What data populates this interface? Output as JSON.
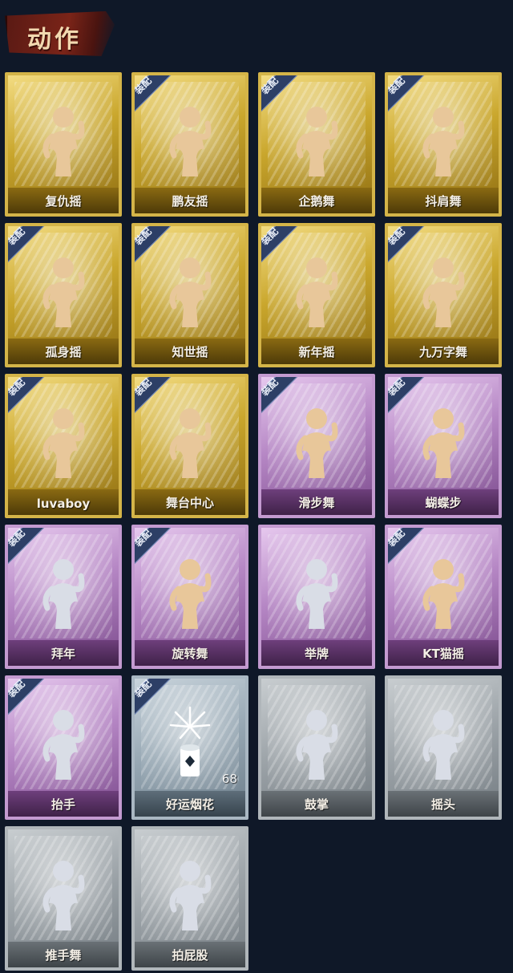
{
  "header": {
    "title": "动作"
  },
  "equip_label": "装配",
  "colors": {
    "gold": "#c9a62c",
    "purple": "#b586c4",
    "blue": "#95a6b2",
    "grey": "#9aa1a6",
    "figure_gold": "#e8c79a",
    "figure_pale": "#d9dde6"
  },
  "cards": [
    {
      "name": "复仇摇",
      "rarity": "gold",
      "equipped": false
    },
    {
      "name": "鹏友摇",
      "rarity": "gold",
      "equipped": true
    },
    {
      "name": "企鹅舞",
      "rarity": "gold",
      "equipped": true
    },
    {
      "name": "抖肩舞",
      "rarity": "gold",
      "equipped": true
    },
    {
      "name": "孤身摇",
      "rarity": "gold",
      "equipped": true
    },
    {
      "name": "知世摇",
      "rarity": "gold",
      "equipped": true
    },
    {
      "name": "新年摇",
      "rarity": "gold",
      "equipped": true
    },
    {
      "name": "九万字舞",
      "rarity": "gold",
      "equipped": true
    },
    {
      "name": "luvaboy",
      "rarity": "gold",
      "equipped": true
    },
    {
      "name": "舞台中心",
      "rarity": "gold",
      "equipped": true
    },
    {
      "name": "滑步舞",
      "rarity": "purple",
      "equipped": true
    },
    {
      "name": "蝴蝶步",
      "rarity": "purple",
      "equipped": true
    },
    {
      "name": "拜年",
      "rarity": "purple",
      "equipped": true
    },
    {
      "name": "旋转舞",
      "rarity": "purple",
      "equipped": true
    },
    {
      "name": "举牌",
      "rarity": "purple",
      "equipped": false
    },
    {
      "name": "KT猫摇",
      "rarity": "purple",
      "equipped": true
    },
    {
      "name": "抬手",
      "rarity": "purple",
      "equipped": true
    },
    {
      "name": "好运烟花",
      "rarity": "blue",
      "equipped": true,
      "count": "68",
      "item": true
    },
    {
      "name": "鼓掌",
      "rarity": "grey",
      "equipped": false
    },
    {
      "name": "摇头",
      "rarity": "grey",
      "equipped": false
    },
    {
      "name": "推手舞",
      "rarity": "grey",
      "equipped": false
    },
    {
      "name": "拍屁股",
      "rarity": "grey",
      "equipped": false
    }
  ]
}
